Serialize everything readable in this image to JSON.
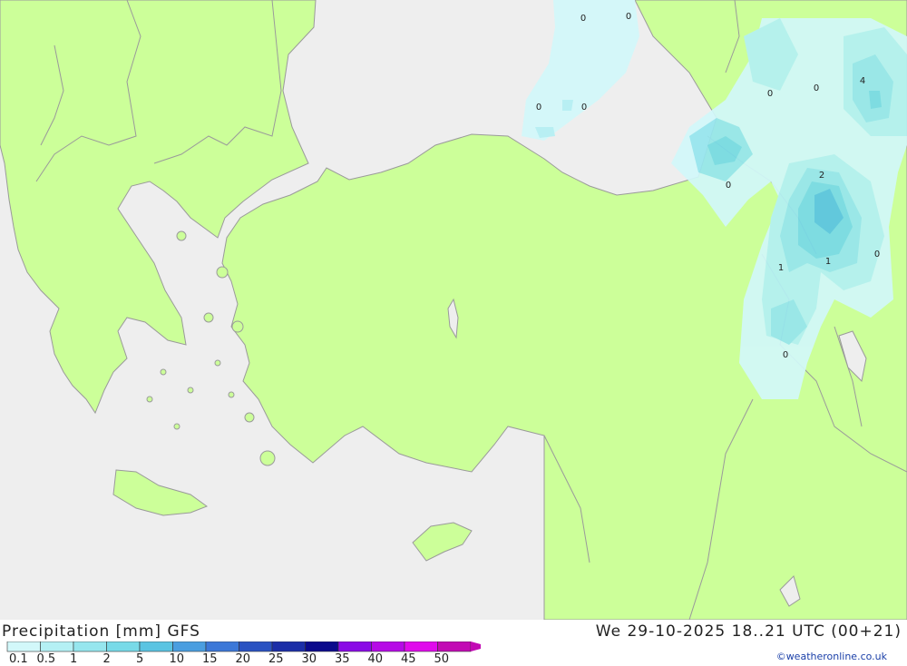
{
  "title": "Precipitation [mm] GFS",
  "valid_time": "We 29-10-2025 18..21 UTC (00+21)",
  "credit": "©weatheronline.co.uk",
  "legend": {
    "labels": [
      "0.1",
      "0.5",
      "1",
      "2",
      "5",
      "10",
      "15",
      "20",
      "25",
      "30",
      "35",
      "40",
      "45",
      "50"
    ],
    "colors": [
      "#d2f8fa",
      "#b4f0f4",
      "#96e6ee",
      "#78dae8",
      "#5ac4e2",
      "#4a9ee0",
      "#3c78d8",
      "#2a52c2",
      "#1b2ea8",
      "#0b0a8c",
      "#8a0ae6",
      "#b60ae6",
      "#e00aec",
      "#c20ab4"
    ]
  },
  "colors": {
    "land": "#ccff99",
    "sea": "#eeeeee",
    "border": "#9a9a9a"
  },
  "map_labels": [
    "0",
    "0",
    "0",
    "0",
    "0",
    "0",
    "4",
    "0",
    "2",
    "1",
    "1",
    "0",
    "0"
  ]
}
